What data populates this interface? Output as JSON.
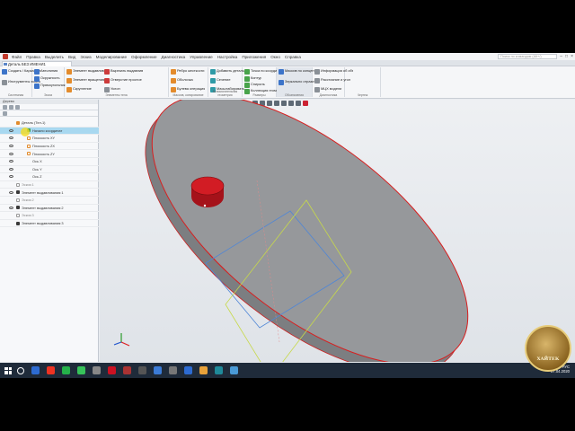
{
  "menu": {
    "items": [
      "Файл",
      "Правка",
      "Выделить",
      "Вид",
      "Эскиз",
      "Моделирование",
      "Оформление",
      "Диагностика",
      "Управление",
      "Настройка",
      "Приложения",
      "Окно",
      "Справка"
    ],
    "search_placeholder": "Поиск по командам (Alt+/)"
  },
  "document": {
    "tab_title": "Деталь БЕЗ ИМЕНИ1"
  },
  "ribbon": {
    "groups": [
      {
        "label": "Системная",
        "buttons": [
          "Создать / Каркас и поверхности",
          "Инструменты эскиза"
        ]
      },
      {
        "label": "Эскиз",
        "buttons": [
          "Автолиния",
          "Окружность",
          "Прямоугольник"
        ]
      },
      {
        "label": "Элементы тела",
        "buttons": [
          "Элемент выдавливания",
          "Элемент вращения",
          "Скругление",
          "Вырезать выдавливанием",
          "Отверстие простое",
          "Уклон"
        ]
      },
      {
        "label": "Массив, копирование",
        "buttons": [
          "Ребро жесткости",
          "Оболочка",
          "Булева операция"
        ]
      },
      {
        "label": "Вспомогательная геометрия",
        "buttons": [
          "Добавить деталь-заготовку",
          "Сечение",
          "Масштабировать"
        ]
      },
      {
        "label": "Размеры",
        "buttons": [
          "Точка по координатам",
          "Контур",
          "Спираль",
          "Коллекция геометрии"
        ]
      },
      {
        "label": "Обозначения",
        "buttons": [
          "Массив по концентрической",
          "Зеркально отразить"
        ]
      },
      {
        "label": "Диагностика",
        "buttons": [
          "Информация об объекте",
          "Расстояние и угол",
          "МЦХ модели"
        ]
      },
      {
        "label": "Чертеж",
        "buttons": []
      }
    ]
  },
  "panel": {
    "title": "Дерево",
    "tree": [
      {
        "label": "Деталь (Тел-1)",
        "selected": false
      },
      {
        "label": "Начало координат",
        "selected": true
      },
      {
        "label": "Плоскость XY",
        "selected": false
      },
      {
        "label": "Плоскость ZX",
        "selected": false
      },
      {
        "label": "Плоскость ZY",
        "selected": false
      },
      {
        "label": "Ось X",
        "selected": false
      },
      {
        "label": "Ось Y",
        "selected": false
      },
      {
        "label": "Ось Z",
        "selected": false
      },
      {
        "label": "Эскиз:1",
        "selected": false
      },
      {
        "label": "Элемент выдавливания:1",
        "selected": false
      },
      {
        "label": "Эскиз:2",
        "selected": false
      },
      {
        "label": "Элемент выдавливания:2",
        "selected": false
      },
      {
        "label": "Эскиз:3",
        "selected": false
      },
      {
        "label": "Элемент выдавливания:3",
        "selected": false
      }
    ]
  },
  "taskbar": {
    "lang": "РУС",
    "date": "07.04.2020"
  },
  "watermark": {
    "text": "ХАЙТЕК"
  },
  "colors": {
    "disk_face": "#8d8f92",
    "disk_edge": "#d91e1e",
    "knob": "#c4161c",
    "selection": "#a8d8f0"
  }
}
